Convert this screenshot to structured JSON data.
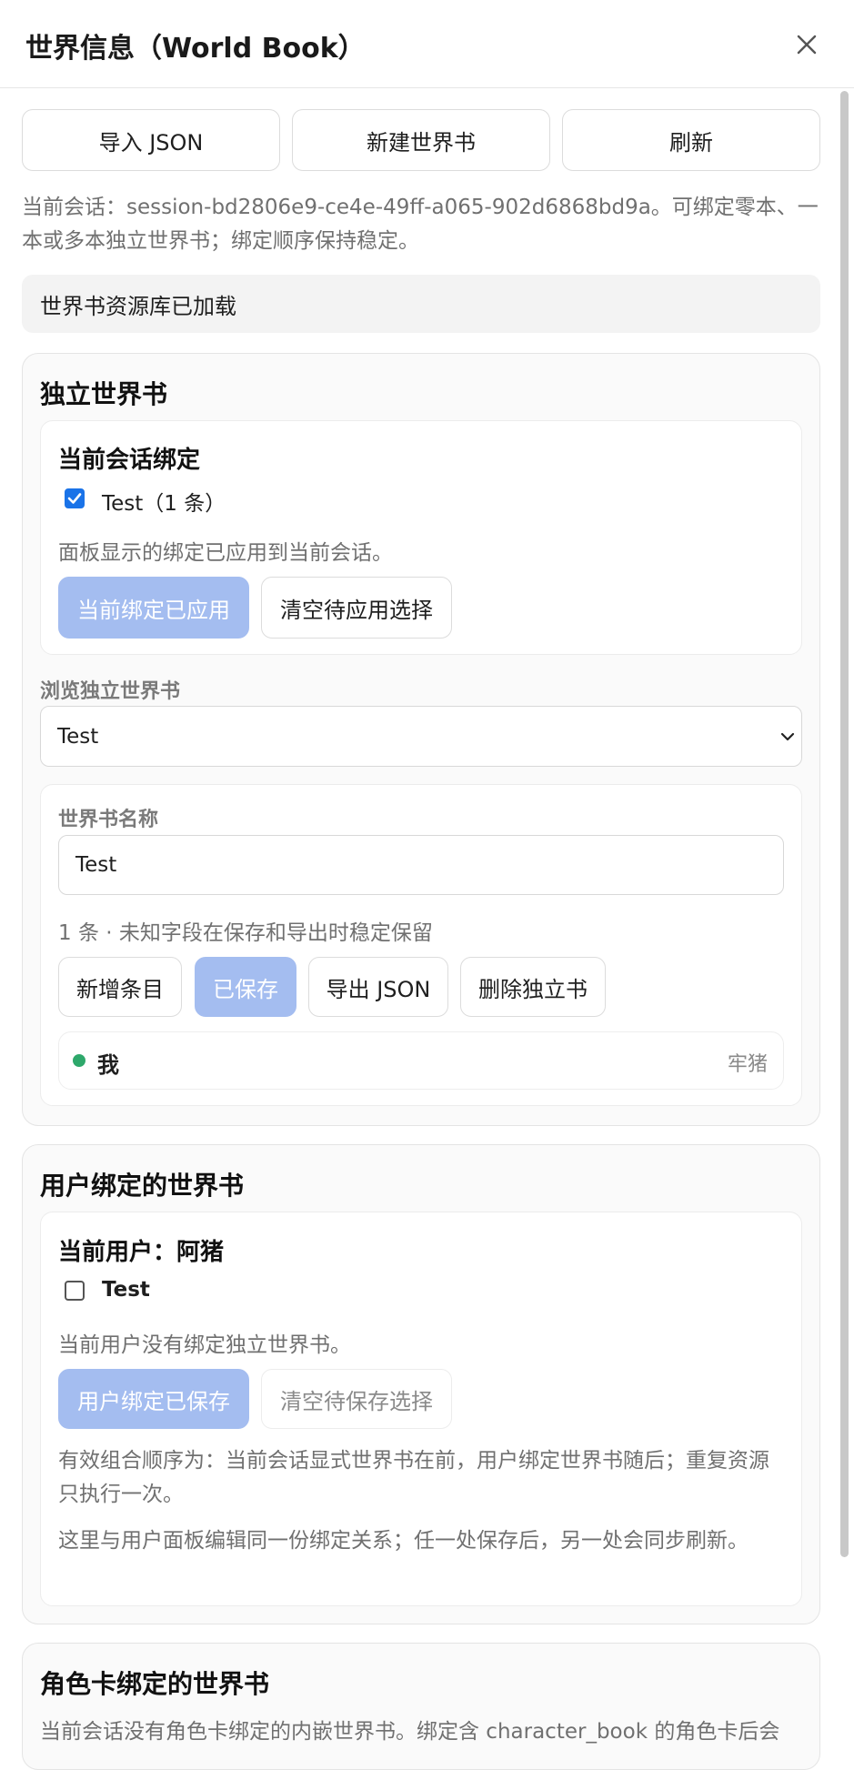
{
  "header": {
    "title": "世界信息（World Book）"
  },
  "toolbar": {
    "import_label": "导入 JSON",
    "new_label": "新建世界书",
    "refresh_label": "刷新"
  },
  "session_info": "当前会话：session-bd2806e9-ce4e-49ff-a065-902d6868bd9a。可绑定零本、一本或多本独立世界书；绑定顺序保持稳定。",
  "status_banner": "世界书资源库已加载",
  "standalone": {
    "title": "独立世界书",
    "session_binding": {
      "title": "当前会话绑定",
      "book_item": {
        "label": "Test（1 条）",
        "checked": true
      },
      "hint": "面板显示的绑定已应用到当前会话。",
      "apply_label": "当前绑定已应用",
      "clear_label": "清空待应用选择"
    },
    "browse_label": "浏览独立世界书",
    "browse_selected": "Test",
    "editor": {
      "name_label": "世界书名称",
      "name_value": "Test",
      "meta": "1 条 · 未知字段在保存和导出时稳定保留",
      "add_label": "新增条目",
      "saved_label": "已保存",
      "export_label": "导出 JSON",
      "delete_label": "删除独立书",
      "entry": {
        "title": "我",
        "keyword": "牢猪",
        "status_color": "#2ea86b"
      }
    }
  },
  "user_bound": {
    "title": "用户绑定的世界书",
    "current_user": "当前用户：阿猪",
    "book_item": {
      "label": "Test",
      "checked": false
    },
    "hint": "当前用户没有绑定独立世界书。",
    "saved_label": "用户绑定已保存",
    "clear_label": "清空待保存选择",
    "note1": "有效组合顺序为：当前会话显式世界书在前，用户绑定世界书随后；重复资源只执行一次。",
    "note2": "这里与用户面板编辑同一份绑定关系；任一处保存后，另一处会同步刷新。"
  },
  "character_bound": {
    "title": "角色卡绑定的世界书",
    "hint": "当前会话没有角色卡绑定的内嵌世界书。绑定含 character_book 的角色卡后会"
  },
  "colors": {
    "accent": "#1a73e8",
    "primary_disabled": "#a4bdf0",
    "green_dot": "#2ea86b"
  }
}
